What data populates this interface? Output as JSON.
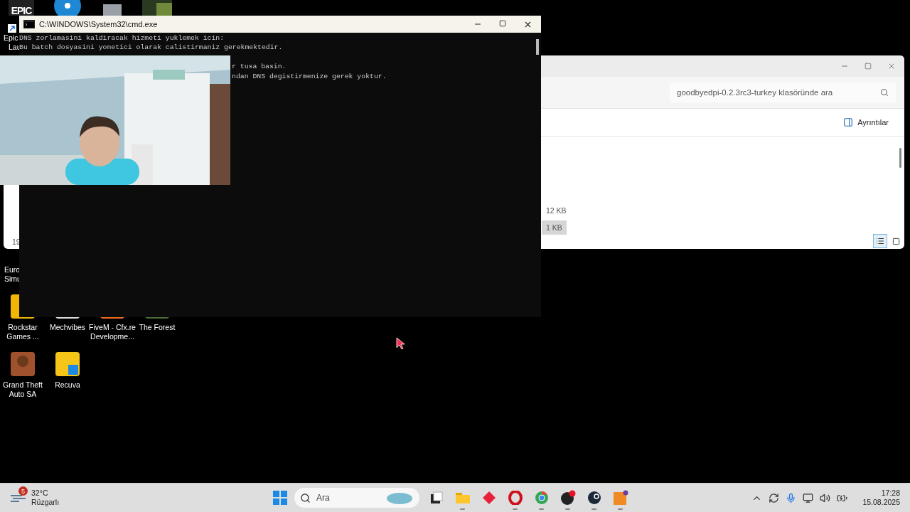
{
  "desktop": {
    "partial_labels": [
      {
        "text": "Epic"
      },
      {
        "text": "Lau"
      },
      {
        "text": "Euro"
      },
      {
        "text": "Simu"
      }
    ],
    "logo_text": "EPIC",
    "icons": [
      {
        "kind": "rockstar",
        "lines": [
          "Rockstar",
          "Games ..."
        ]
      },
      {
        "kind": "mechvibes",
        "lines": [
          "Mechvibes"
        ]
      },
      {
        "kind": "fivem",
        "lines": [
          "FiveM - Cfx.re",
          "Developme..."
        ]
      },
      {
        "kind": "forest",
        "lines": [
          "The Forest"
        ]
      },
      {
        "kind": "gta",
        "lines": [
          "Grand Theft",
          "Auto SA"
        ]
      },
      {
        "kind": "recuva",
        "lines": [
          "Recuva"
        ]
      }
    ]
  },
  "explorer": {
    "search": {
      "placeholder": "goodbyedpi-0.2.3rc3-turkey klasöründe ara"
    },
    "details_button": "Ayrıntılar",
    "partial_text": "19",
    "rows": [
      {
        "size": "12 KB",
        "selected": false
      },
      {
        "size": "1 KB",
        "selected": true
      }
    ],
    "view_buttons": [
      {
        "kind": "details",
        "selected": true
      },
      {
        "kind": "tiles",
        "selected": false
      }
    ]
  },
  "cmd": {
    "title": "C:\\WINDOWS\\System32\\cmd.exe",
    "lines": [
      "DNS zorlamasini kaldiracak hizmeti yuklemek icin:",
      "Bu batch dosyasini yonetici olarak calistirmaniz gerekmektedir.",
      "r tusa basin.",
      "ndan DNS degistirmenize gerek yoktur."
    ]
  },
  "taskbar": {
    "weather": {
      "badge": "5",
      "temperature": "32°C",
      "condition": "Rüzgarlı"
    },
    "search": {
      "placeholder": "Ara"
    },
    "apps": [
      {
        "kind": "taskview",
        "running": false
      },
      {
        "kind": "folder",
        "running": true
      },
      {
        "kind": "diamond",
        "running": false
      },
      {
        "kind": "opera",
        "running": true
      },
      {
        "kind": "chrome",
        "running": true
      },
      {
        "kind": "obs",
        "running": true
      },
      {
        "kind": "steam",
        "running": true
      },
      {
        "kind": "orange",
        "running": true
      }
    ],
    "time": "17:28",
    "date": "15.08.2025"
  }
}
